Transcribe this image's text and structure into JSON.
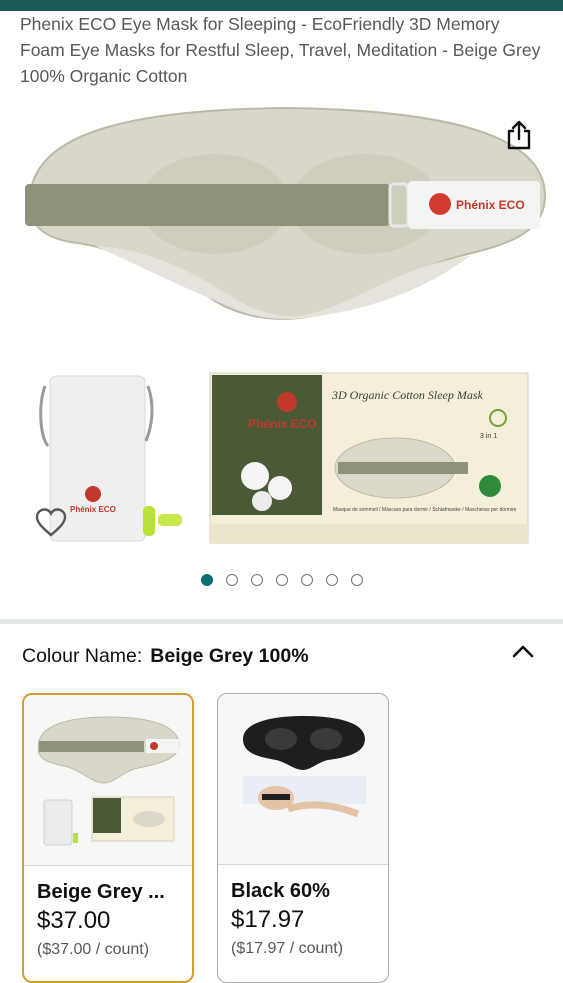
{
  "product": {
    "title": "Phenix ECO Eye Mask for Sleeping - EcoFriendly 3D Memory Foam Eye Masks for Restful Sleep, Travel, Meditation - Beige Grey 100% Organic Cotton"
  },
  "gallery": {
    "brand_logo_text": "Phénix ECO",
    "box_title": "3D Organic Cotton Sleep Mask",
    "box_badge": "3 in 1",
    "box_caption": "Masque de sommeil / Máscara para dormir / Schlafmaske / Mascheras per dormire",
    "dot_count": 7,
    "active_dot": 0
  },
  "colour": {
    "label": "Colour Name:",
    "value": "Beige Grey 100%"
  },
  "options": [
    {
      "name": "Beige Grey ...",
      "price": "$37.00",
      "unit_price": "($37.00 / count)"
    },
    {
      "name": "Black 60%",
      "price": "$17.97",
      "unit_price": "($17.97 / count)"
    }
  ],
  "colors": {
    "accent": "#0b6f76",
    "selected_border": "#d79b2f",
    "top_bar": "#1b5b57"
  },
  "icons": [
    "share-icon",
    "heart-icon",
    "chevron-up-icon"
  ]
}
